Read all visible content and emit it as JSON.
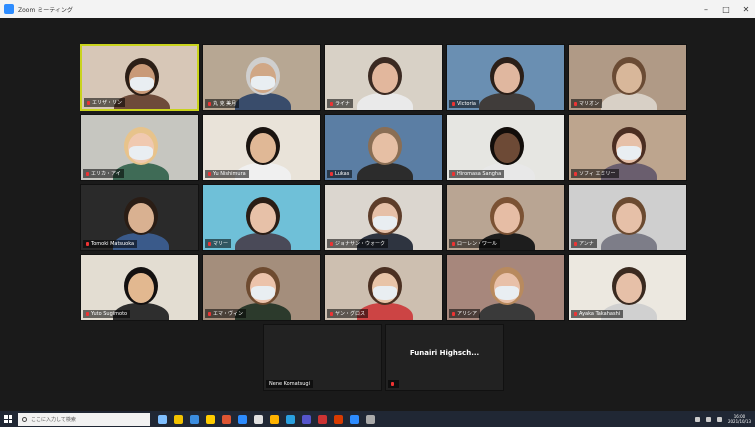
{
  "window": {
    "title": "Zoom ミーティング",
    "minimize": "–",
    "maximize": "□",
    "close": "✕"
  },
  "participants": [
    {
      "name": "エリザ・リン",
      "bg": "#d7c7b7",
      "skin": "#c99a78",
      "hair": "#2b1e16",
      "shirt": "#6d4b3a",
      "mask": true,
      "active": true
    },
    {
      "name": "丸 克 美月",
      "bg": "#b7a793",
      "skin": "#d0a786",
      "hair": "#cfcfcf",
      "shirt": "#394c6b",
      "mask": true
    },
    {
      "name": "ライナ",
      "bg": "#d8d1c6",
      "skin": "#e2b79d",
      "hair": "#3b2a22",
      "shirt": "#eaeaea",
      "mask": false
    },
    {
      "name": "Victoria",
      "bg": "#6a8fb2",
      "skin": "#e0b79f",
      "hair": "#2b1f18",
      "shirt": "#403c3a",
      "mask": false
    },
    {
      "name": "マリオン",
      "bg": "#b09a86",
      "skin": "#d8b79a",
      "hair": "#6a4b34",
      "shirt": "#d8d0c6",
      "mask": false
    },
    {
      "name": "エリカ・アイ",
      "bg": "#c6c6c0",
      "skin": "#f0c9b0",
      "hair": "#e7c38b",
      "shirt": "#3f6b56",
      "mask": true
    },
    {
      "name": "Yu Nishimura",
      "bg": "#e9e3d9",
      "skin": "#e0b896",
      "hair": "#1a1410",
      "shirt": "#f0f0f0",
      "mask": false
    },
    {
      "name": "Lukas",
      "bg": "#5b7ea4",
      "skin": "#e6bfa4",
      "hair": "#8a6e54",
      "shirt": "#2c2c2c",
      "mask": false
    },
    {
      "name": "Hiromasa Sangha",
      "bg": "#e6e6e2",
      "skin": "#6d4a36",
      "hair": "#120d0a",
      "shirt": "#e8e8e8",
      "mask": false
    },
    {
      "name": "ソフィ エミリー",
      "bg": "#bda58e",
      "skin": "#e6c0a8",
      "hair": "#4b2e22",
      "shirt": "#6a5e6e",
      "mask": true
    },
    {
      "name": "Tomoki Matsuoka",
      "bg": "#2a2a2a",
      "skin": "#d9b191",
      "hair": "#2a1d15",
      "shirt": "#3a5a8a",
      "mask": false
    },
    {
      "name": "マリー",
      "bg": "#6fc0d8",
      "skin": "#e7c1a8",
      "hair": "#2a1d15",
      "shirt": "#4a4a58",
      "mask": false
    },
    {
      "name": "ジョナサン・ウォーク",
      "bg": "#dbd6cf",
      "skin": "#e6c0a8",
      "hair": "#5d3d2a",
      "shirt": "#2e3440",
      "mask": true
    },
    {
      "name": "ローレン・ワール",
      "bg": "#b9a593",
      "skin": "#e6bda5",
      "hair": "#7b5234",
      "shirt": "#1d1d1d",
      "mask": false
    },
    {
      "name": "アンナ",
      "bg": "#cfcfcf",
      "skin": "#e6c0a8",
      "hair": "#6b4a30",
      "shirt": "#7d7d88",
      "mask": false
    },
    {
      "name": "Yuto Sugimoto",
      "bg": "#e3ddd2",
      "skin": "#e2b890",
      "hair": "#131010",
      "shirt": "#2e2e2e",
      "mask": false
    },
    {
      "name": "エマ・ヴィン",
      "bg": "#a48e7c",
      "skin": "#ecc3ab",
      "hair": "#6e4b30",
      "shirt": "#2c3a2c",
      "mask": true
    },
    {
      "name": "ヤン・グロス",
      "bg": "#cdbfb0",
      "skin": "#e8c4a8",
      "hair": "#4b3022",
      "shirt": "#c44",
      "mask": true
    },
    {
      "name": "アリシア",
      "bg": "#a7877c",
      "skin": "#e8c0a8",
      "hair": "#b88a5e",
      "shirt": "#3a3a3a",
      "mask": true
    },
    {
      "name": "Ayaka Takahashi",
      "bg": "#ece8e0",
      "skin": "#e6c0a8",
      "hair": "#3a2a20",
      "shirt": "#d0d0d0",
      "mask": false
    }
  ],
  "bottom_tiles": [
    {
      "name": "Nene Komatsugi",
      "title": ""
    },
    {
      "name": "",
      "title": "Funairi  Highsch..."
    }
  ],
  "taskbar": {
    "search_placeholder": "ここに入力して検索",
    "apps": [
      "#7fbfff",
      "#f2c200",
      "#3b8de0",
      "#ffcc00",
      "#d53",
      "#2d8cff",
      "#e0e0e0",
      "#ffb300",
      "#2aa0e0",
      "#55c",
      "#c33",
      "#d83b01",
      "#2d8cff",
      "#aaa"
    ],
    "clock_time": "16:00",
    "clock_date": "2021/10/13"
  }
}
